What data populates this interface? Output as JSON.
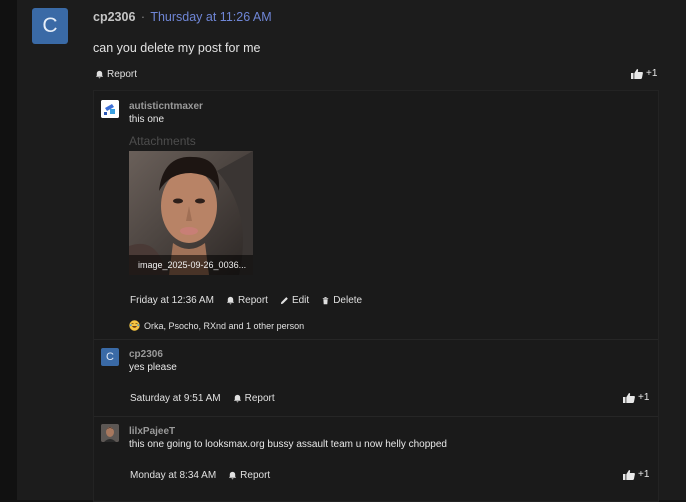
{
  "main_post": {
    "avatar_letter": "C",
    "username": "cp2306",
    "separator": "·",
    "timestamp": "Thursday at 11:26 AM",
    "body": "can you delete my post for me",
    "report_label": "Report",
    "like_count": "+1"
  },
  "replies": [
    {
      "username": "autisticntmaxer",
      "text": "this one",
      "attachments_title": "Attachments",
      "attachment_name": "image_2025-09-26_0036...",
      "timestamp": "Friday at 12:36 AM",
      "report_label": "Report",
      "edit_label": "Edit",
      "delete_label": "Delete",
      "reaction_summary": "Orka, Psocho, RXnd and 1 other person"
    },
    {
      "avatar_letter": "C",
      "username": "cp2306",
      "text": "yes please",
      "timestamp": "Saturday at 9:51 AM",
      "report_label": "Report",
      "like_count": "+1"
    },
    {
      "username": "lilxPajeeT",
      "text": "this one going to looksmax.org bussy assault team u now helly chopped",
      "timestamp": "Monday at 8:34 AM",
      "report_label": "Report",
      "like_count": "+1"
    }
  ],
  "colors": {
    "accent_time": "#6f86d6",
    "avatar_blue": "#3a6aa6",
    "background": "#1c1c1c"
  }
}
